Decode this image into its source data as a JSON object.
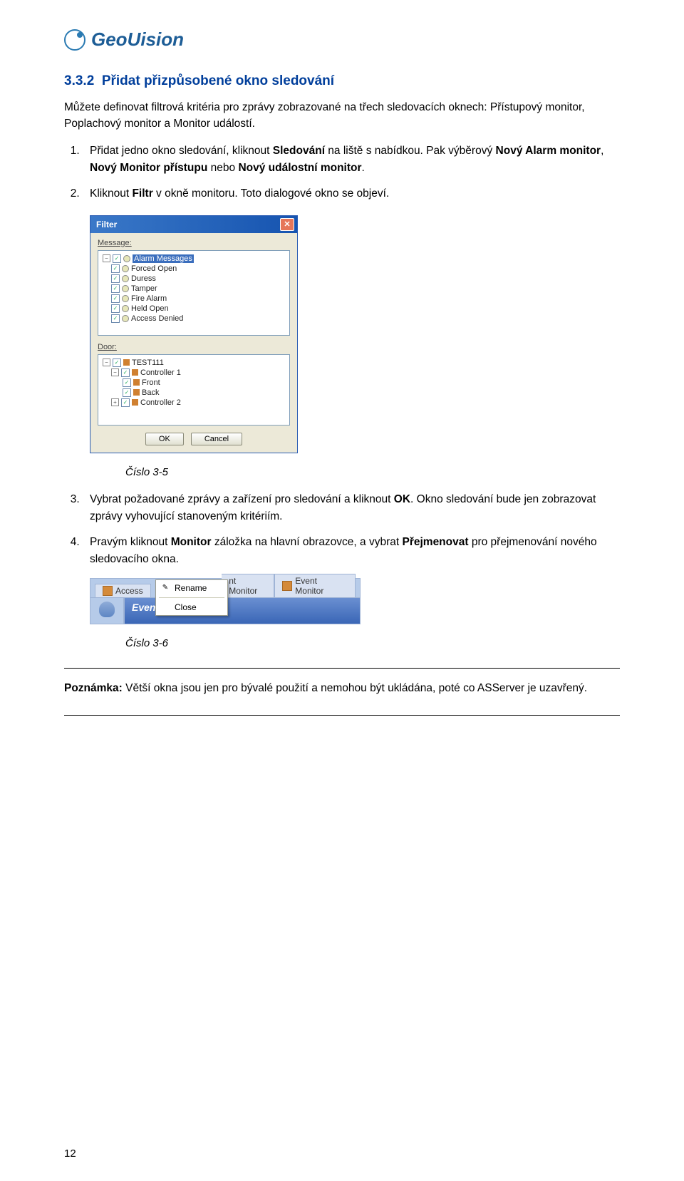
{
  "logo": {
    "text": "GeoUision"
  },
  "section": {
    "number": "3.3.2",
    "title": "Přidat přizpůsobené okno sledování"
  },
  "intro": "Můžete definovat filtrová kritéria pro zprávy zobrazované na třech sledovacích oknech: Přístupový monitor, Poplachový monitor a Monitor událostí.",
  "steps": {
    "s1_a": "Přidat jedno okno sledování, kliknout ",
    "s1_b": "Sledování",
    "s1_c": " na liště s nabídkou. Pak výběrový ",
    "s1_d": "Nový Alarm monitor",
    "s1_e": ", ",
    "s1_f": "Nový Monitor přístupu",
    "s1_g": " nebo ",
    "s1_h": "Nový událostní monitor",
    "s1_i": ".",
    "s2_a": "Kliknout ",
    "s2_b": "Filtr",
    "s2_c": " v okně monitoru. Toto dialogové okno se objeví.",
    "s3_a": "Vybrat požadované zprávy a zařízení pro sledování a kliknout ",
    "s3_b": "OK",
    "s3_c": ". Okno sledování bude jen zobrazovat zprávy vyhovující stanoveným kritériím.",
    "s4_a": "Pravým kliknout ",
    "s4_b": "Monitor",
    "s4_c": " záložka na hlavní obrazovce, a vybrat ",
    "s4_d": "Přejmenovat",
    "s4_e": " pro přejmenování nového sledovacího okna."
  },
  "filter_dialog": {
    "title": "Filter",
    "label_message": "Message:",
    "label_door": "Door:",
    "tree_msg_root": "Alarm Messages",
    "tree_msg_items": [
      "Forced Open",
      "Duress",
      "Tamper",
      "Fire Alarm",
      "Held Open",
      "Access Denied"
    ],
    "tree_door_root": "TEST111",
    "tree_door_ctrl1": "Controller 1",
    "tree_door_front": "Front",
    "tree_door_back": "Back",
    "tree_door_ctrl2": "Controller 2",
    "btn_ok": "OK",
    "btn_cancel": "Cancel"
  },
  "caption1": "Číslo 3-5",
  "ctx": {
    "tab_access": "Access",
    "tab_nt": "nt Monitor",
    "tab_event": "Event Monitor",
    "bar": "Event",
    "menu_rename": "Rename",
    "menu_close": "Close"
  },
  "caption2": "Číslo 3-6",
  "note_label": "Poznámka:",
  "note_text": " Větší okna jsou jen pro bývalé použití a nemohou být ukládána, poté co ASServer je uzavřený.",
  "page_number": "12"
}
